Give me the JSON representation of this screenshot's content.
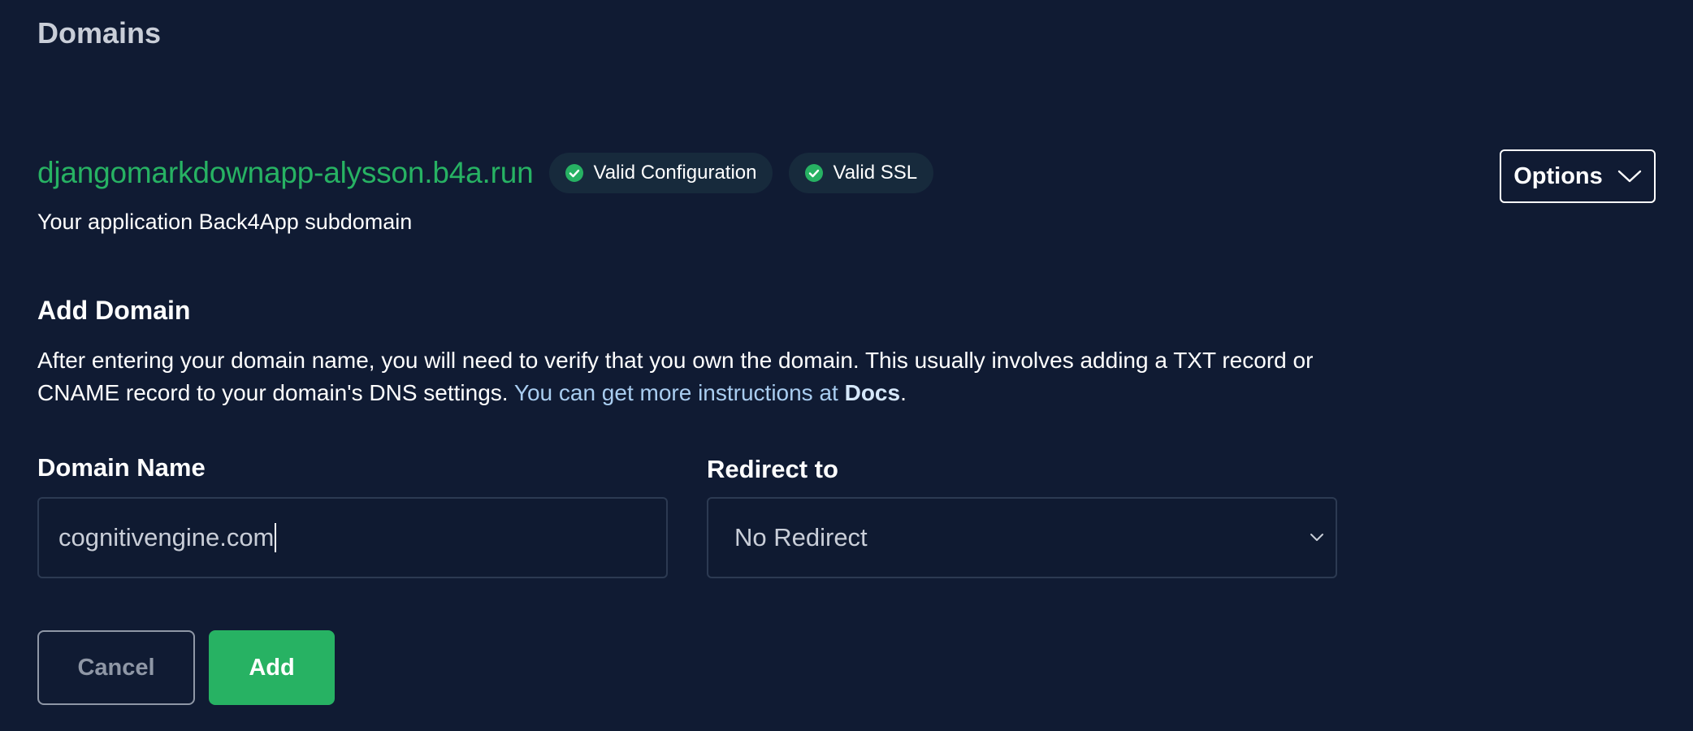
{
  "page": {
    "title": "Domains"
  },
  "subdomain": {
    "name": "djangomarkdownapp-alysson.b4a.run",
    "description": "Your application Back4App subdomain",
    "badges": [
      {
        "label": "Valid Configuration",
        "icon": "check-circle-icon",
        "color": "#27b263"
      },
      {
        "label": "Valid SSL",
        "icon": "check-circle-icon",
        "color": "#27b263"
      }
    ],
    "options_label": "Options",
    "options_icon": "chevron-down-icon"
  },
  "add_domain": {
    "heading": "Add Domain",
    "description": "After entering your domain name, you will need to verify that you own the domain. This usually involves adding a TXT record or CNAME record to your domain's DNS settings.",
    "instructions_prefix": "You can get more instructions at",
    "docs_label": "Docs",
    "instructions_suffix": ".",
    "domain_name": {
      "label": "Domain Name",
      "value": "cognitivengine.com"
    },
    "redirect": {
      "label": "Redirect to",
      "selected": "No Redirect"
    },
    "cancel_label": "Cancel",
    "add_label": "Add"
  },
  "colors": {
    "background": "#101b33",
    "accent_green": "#27b263",
    "link_blue": "#a9cdf0"
  }
}
